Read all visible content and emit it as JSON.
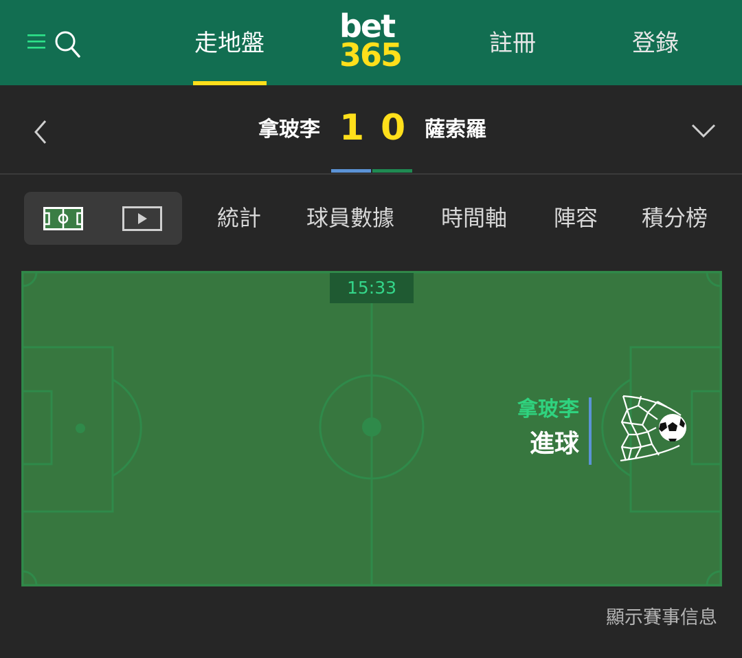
{
  "header": {
    "nav": {
      "inplay": "走地盤",
      "register": "註冊",
      "login": "登錄"
    },
    "logo": {
      "line1": "bet",
      "line2": "365"
    },
    "colors": {
      "header_bg": "#126e51",
      "accent": "#ffdf1b"
    }
  },
  "match": {
    "home_team": "拿玻李",
    "away_team": "薩索羅",
    "home_score": "1",
    "away_score": "0"
  },
  "tabs": {
    "stats": "統計",
    "players": "球員數據",
    "timeline": "時間軸",
    "lineups": "陣容",
    "standings": "積分榜"
  },
  "pitch": {
    "clock": "15:33",
    "event_team": "拿玻李",
    "event_label": "進球",
    "event_icon": "goal-net-ball-icon"
  },
  "footer": {
    "match_info": "顯示賽事信息"
  }
}
